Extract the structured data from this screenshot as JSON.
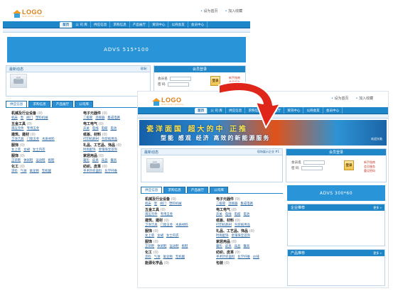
{
  "logo": {
    "name": "LOGO",
    "sub": "INDUSTRY PORTAL"
  },
  "toplinks": [
    "设为首页",
    "加入收藏"
  ],
  "nav": [
    "首页",
    "公 司 库",
    "供应信息",
    "求购信息",
    "产品展厅",
    "资讯中心",
    "以商会友",
    "会员中心"
  ],
  "back": {
    "ad_label": "ADVS 515*100",
    "news_head": "最新动态",
    "news_more": "现场(",
    "login_head": "会员登录",
    "username_label": "会员名",
    "password_label": "密 码",
    "login_btn": "登录",
    "links": [
      "新手指南",
      "会员服务",
      "重设密码"
    ],
    "tabs": [
      "供应信息",
      "求购信息",
      "产品展厅",
      "公司库"
    ],
    "cats": [
      {
        "title": "机械及行业设备",
        "count": "(0)",
        "subs": [
          "机床",
          "泵",
          "阀门",
          "塑料机械"
        ]
      },
      {
        "title": "电子元器件",
        "count": "(0)",
        "subs": [
          "二极管",
          "连接器",
          "集成电路"
        ]
      },
      {
        "title": "五金工具",
        "count": "(0)",
        "subs": [
          "液压元件",
          "专用五金"
        ]
      },
      {
        "title": "电工电气",
        "count": "(0)",
        "subs": [
          "开关",
          "电线",
          "电缆",
          "电池"
        ]
      },
      {
        "title": "建筑、建材",
        "count": "(0)",
        "subs": [
          "卫浴洁具",
          "门窗五金",
          "木质材料"
        ]
      },
      {
        "title": "纸板、材料",
        "count": "(0)",
        "subs": [
          "打印机耗材",
          "包装纸用品"
        ]
      },
      {
        "title": "服饰",
        "count": "(0)",
        "subs": [
          "女上装",
          "女裙",
          "女士内衣"
        ]
      },
      {
        "title": "礼品、工艺品、饰品",
        "count": "(0)",
        "subs": [
          "时尚配饰",
          "金银珠宝首饰"
        ]
      },
      {
        "title": "服饰",
        "count": "(0)",
        "subs": [
          "正装鞋",
          "休闲鞋",
          "运动鞋",
          "拖鞋"
        ]
      },
      {
        "title": "家居用品",
        "count": "(0)",
        "subs": [
          "箱包",
          "皮具",
          "床品",
          "餐具"
        ]
      },
      {
        "title": "化工",
        "count": "(0)",
        "subs": [
          "涂料",
          "气体",
          "氧化物",
          "无机酸"
        ]
      },
      {
        "title": "纺织、皮革",
        "count": "(0)",
        "subs": [
          "手术针织面料",
          "化学纤维"
        ]
      }
    ]
  },
  "front": {
    "banner_line1": "瓷洋面国 超大的中 正推",
    "banner_line2": "型能 感观 经济 高效的新能源服务",
    "banner_corner": "欢迎光临",
    "news_head": "最新动态",
    "news_more": "现场展示企业 #1",
    "login_head": "会员登录",
    "username_label": "会员名",
    "password_label": "密 码",
    "login_btn": "登录",
    "links": [
      "新手指南",
      "会员服务",
      "重设密码"
    ],
    "ad_label": "ADVS 300*60",
    "rec1_head": "企业推荐",
    "rec2_head": "产品推荐",
    "more": "更多",
    "tabs": [
      "供应信息",
      "求购信息",
      "产品展厅",
      "公司库"
    ],
    "cats": [
      {
        "title": "机械及行业设备",
        "count": "(0)",
        "subs": [
          "机床",
          "泵",
          "阀门",
          "塑料机械"
        ]
      },
      {
        "title": "电子元器件",
        "count": "(0)",
        "subs": [
          "二极管",
          "连接器",
          "集成电路"
        ]
      },
      {
        "title": "五金工具",
        "count": "(0)",
        "subs": [
          "液压元件",
          "专用五金"
        ]
      },
      {
        "title": "电工电气",
        "count": "(0)",
        "subs": [
          "开关",
          "电线",
          "电缆",
          "电池"
        ]
      },
      {
        "title": "建筑、建材",
        "count": "(0)",
        "subs": [
          "卫浴洁具",
          "门窗五金",
          "木质材料"
        ]
      },
      {
        "title": "纸板、材料",
        "count": "(0)",
        "subs": [
          "打印机耗材",
          "包装纸用品"
        ]
      },
      {
        "title": "服饰",
        "count": "(0)",
        "subs": [
          "女上装",
          "女裙",
          "女士内衣"
        ]
      },
      {
        "title": "礼品、工艺品、饰品",
        "count": "(0)",
        "subs": [
          "时尚配饰",
          "金银珠宝首饰"
        ]
      },
      {
        "title": "服饰",
        "count": "(0)",
        "subs": [
          "正装鞋",
          "休闲鞋",
          "运动鞋",
          "拖鞋"
        ]
      },
      {
        "title": "家居用品",
        "count": "(0)",
        "subs": [
          "箱包",
          "皮具",
          "床品",
          "餐具"
        ]
      },
      {
        "title": "化工",
        "count": "(0)",
        "subs": [
          "涂料",
          "气体",
          "氧化物",
          "无机酸"
        ]
      },
      {
        "title": "纺织、皮革",
        "count": "(0)",
        "subs": [
          "手术针织面料",
          "化学纤维",
          "纱线"
        ]
      },
      {
        "title": "能源化学品",
        "count": "(0)",
        "subs": []
      },
      {
        "title": "包装",
        "count": "(0)",
        "subs": []
      }
    ]
  },
  "colors": {
    "nav": "#1d86c9",
    "arrow": "#e0261b",
    "ad": "#2a94d8"
  }
}
